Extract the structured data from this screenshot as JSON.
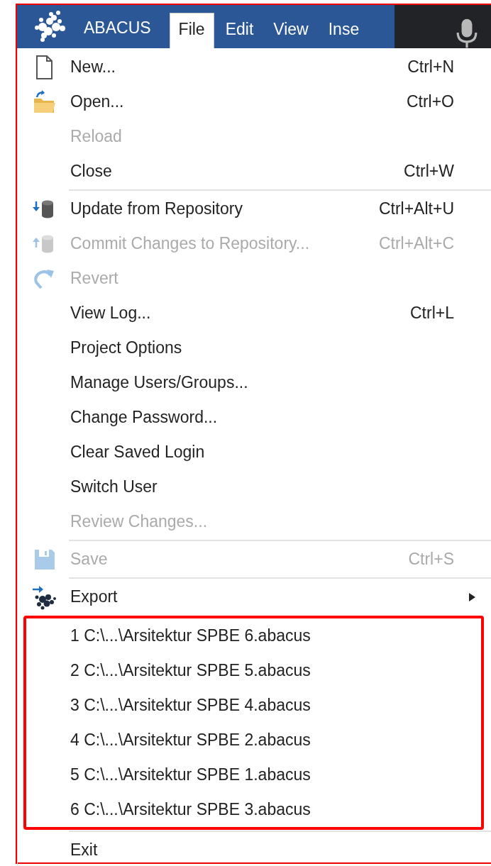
{
  "menubar": {
    "app_name": "ABACUS",
    "menus": [
      {
        "label": "File",
        "selected": true
      },
      {
        "label": "Edit",
        "selected": false
      },
      {
        "label": "View",
        "selected": false
      },
      {
        "label": "Inse",
        "selected": false
      }
    ]
  },
  "file_menu": {
    "groups": [
      {
        "items": [
          {
            "kind": "document",
            "label": "New...",
            "shortcut": "Ctrl+N",
            "disabled": false
          },
          {
            "kind": "folder",
            "label": "Open...",
            "shortcut": "Ctrl+O",
            "disabled": false
          },
          {
            "label": "Reload",
            "disabled": true
          },
          {
            "label": "Close",
            "shortcut": "Ctrl+W",
            "disabled": false
          }
        ]
      },
      {
        "items": [
          {
            "kind": "db-down",
            "label": "Update from Repository",
            "shortcut": "Ctrl+Alt+U",
            "disabled": false
          },
          {
            "kind": "db-up",
            "label": "Commit Changes to Repository...",
            "shortcut": "Ctrl+Alt+C",
            "disabled": true
          },
          {
            "kind": "revert",
            "label": "Revert",
            "disabled": true
          },
          {
            "label": "View Log...",
            "shortcut": "Ctrl+L",
            "disabled": false
          },
          {
            "label": "Project Options",
            "disabled": false
          },
          {
            "label": "Manage Users/Groups...",
            "disabled": false
          },
          {
            "label": "Change Password...",
            "disabled": false
          },
          {
            "label": "Clear Saved Login",
            "disabled": false
          },
          {
            "label": "Switch User",
            "disabled": false
          },
          {
            "label": "Review Changes...",
            "disabled": true
          }
        ]
      },
      {
        "items": [
          {
            "kind": "save",
            "label": "Save",
            "shortcut": "Ctrl+S",
            "disabled": true
          }
        ]
      },
      {
        "items": [
          {
            "kind": "export",
            "label": "Export",
            "submenu": true,
            "disabled": false
          }
        ]
      }
    ],
    "recent_files": {
      "highlighted": true,
      "items": [
        "1 C:\\...\\Arsitektur SPBE 6.abacus",
        "2 C:\\...\\Arsitektur SPBE 5.abacus",
        "3 C:\\...\\Arsitektur SPBE 4.abacus",
        "4 C:\\...\\Arsitektur SPBE 2.abacus",
        "5 C:\\...\\Arsitektur SPBE 1.abacus",
        "6 C:\\...\\Arsitektur SPBE 3.abacus"
      ]
    },
    "last_item": {
      "label": "Exit",
      "disabled": false
    }
  }
}
